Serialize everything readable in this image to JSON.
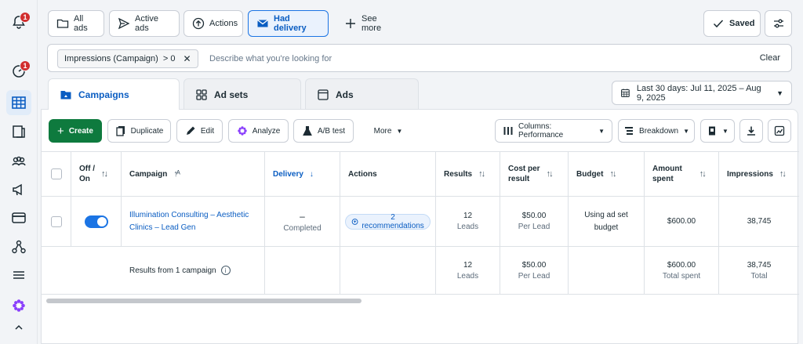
{
  "rail": {
    "notifications_badge": "1",
    "dashboard_badge": "1"
  },
  "filters": {
    "all_ads": "All ads",
    "active_ads": "Active ads",
    "actions": "Actions",
    "had_delivery": "Had delivery",
    "see_more": "See more",
    "saved": "Saved"
  },
  "search": {
    "chip": "Impressions (Campaign)  > 0",
    "placeholder": "Describe what you're looking for",
    "clear": "Clear"
  },
  "tabs": {
    "campaigns": "Campaigns",
    "ad_sets": "Ad sets",
    "ads": "Ads"
  },
  "date_range": "Last 30 days: Jul 11, 2025 – Aug 9, 2025",
  "toolbar": {
    "create": "Create",
    "duplicate": "Duplicate",
    "edit": "Edit",
    "analyze": "Analyze",
    "ab_test": "A/B test",
    "more": "More",
    "columns": "Columns: Performance",
    "breakdown": "Breakdown"
  },
  "table": {
    "headers": {
      "off_on_1": "Off /",
      "off_on_2": "On",
      "campaign": "Campaign",
      "delivery": "Delivery",
      "actions": "Actions",
      "results": "Results",
      "cost_1": "Cost per",
      "cost_2": "result",
      "budget": "Budget",
      "amount_1": "Amount",
      "amount_2": "spent",
      "impressions": "Impressions"
    },
    "row": {
      "campaign_line1": "Illumination Consulting – Aesthetic",
      "campaign_line2": "Clinics – Lead Gen",
      "delivery_dash": "–",
      "delivery_status": "Completed",
      "recommendations": "2 recommendations",
      "results": "12",
      "results_sub": "Leads",
      "cost": "$50.00",
      "cost_sub": "Per Lead",
      "budget_line1": "Using ad set",
      "budget_line2": "budget",
      "amount": "$600.00",
      "impressions": "38,745"
    },
    "summary": {
      "label": "Results from 1 campaign",
      "results": "12",
      "results_sub": "Leads",
      "cost": "$50.00",
      "cost_sub": "Per Lead",
      "amount": "$600.00",
      "amount_sub": "Total spent",
      "impressions": "38,745",
      "impressions_sub": "Total"
    }
  },
  "colors": {
    "accent": "#1b74e4",
    "create": "#0e7a3e",
    "badge": "#d12e2e"
  }
}
